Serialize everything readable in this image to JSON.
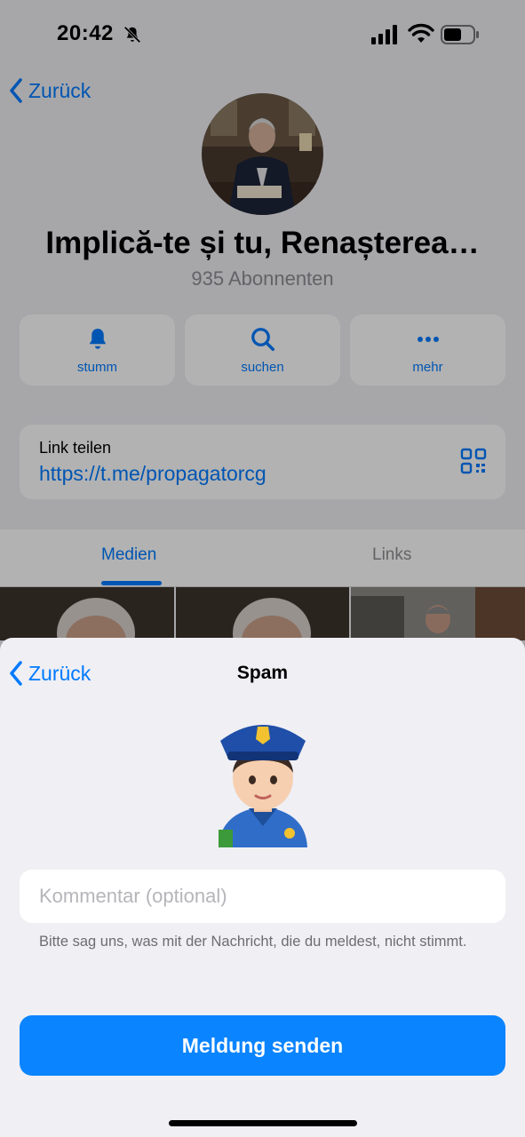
{
  "status_bar": {
    "time": "20:42"
  },
  "channel": {
    "back_label": "Zurück",
    "title": "Implică-te și tu, Renașterea…",
    "subtitle": "935 Abonnenten",
    "actions": [
      {
        "label": "stumm",
        "icon": "bell-icon"
      },
      {
        "label": "suchen",
        "icon": "search-icon"
      },
      {
        "label": "mehr",
        "icon": "more-dots-icon"
      }
    ],
    "link": {
      "label": "Link teilen",
      "url": "https://t.me/propagatorcg"
    },
    "tabs": [
      {
        "label": "Medien",
        "active": true
      },
      {
        "label": "Links",
        "active": false
      }
    ]
  },
  "sheet": {
    "back_label": "Zurück",
    "title": "Spam",
    "comment_placeholder": "Kommentar (optional)",
    "hint": "Bitte sag uns, was mit der Nachricht, die du meldest, nicht stimmt.",
    "send_label": "Meldung senden"
  },
  "colors": {
    "accent": "#007aff",
    "button": "#0a84ff",
    "sheet_bg": "#efeff4"
  }
}
